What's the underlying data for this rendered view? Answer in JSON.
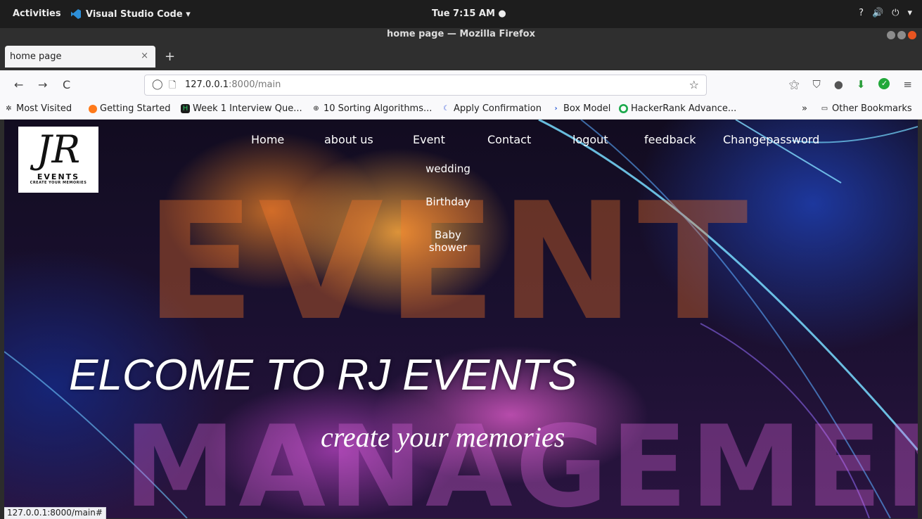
{
  "os": {
    "activities": "Activities",
    "app_name": "Visual Studio Code ▾",
    "clock": "Tue  7:15 AM ●",
    "tray": [
      "?",
      "🔊",
      "⏻",
      "▾"
    ]
  },
  "window": {
    "title": "home page — Mozilla Firefox"
  },
  "browser": {
    "tab_title": "home page",
    "tab_close": "×",
    "new_tab": "+",
    "back": "←",
    "forward": "→",
    "reload": "C",
    "url_host": "127.0.0.1",
    "url_rest": ":8000/main",
    "status_url": "127.0.0.1:8000/main#",
    "bookmarks": [
      {
        "label": "Most Visited",
        "icon": "gear-icon"
      },
      {
        "label": "Getting Started",
        "icon": "firefox-icon"
      },
      {
        "label": "Week 1 Interview Que...",
        "icon": "hr-icon"
      },
      {
        "label": "10 Sorting Algorithms...",
        "icon": "globe-icon"
      },
      {
        "label": "Apply Confirmation",
        "icon": "moon-icon"
      },
      {
        "label": "Box Model",
        "icon": "scrimba-icon"
      },
      {
        "label": "HackerRank Advance...",
        "icon": "hackerrank-icon"
      }
    ],
    "bookmarks_overflow": "»",
    "other_bookmarks": "Other Bookmarks"
  },
  "site": {
    "logo": {
      "monogram": "JR",
      "name": "EVENTS",
      "tagline": "CREATE YOUR MEMORIES"
    },
    "nav": [
      "Home",
      "about us",
      "Event",
      "Contact",
      "logout",
      "feedback",
      "Changepassword"
    ],
    "event_menu": [
      "wedding",
      "Birthday",
      "Baby shower"
    ],
    "headline": "ELCOME TO RJ EVENTS",
    "tagline": "create your memories",
    "background_words": [
      "EVENT",
      "MANAGEMENT"
    ]
  }
}
